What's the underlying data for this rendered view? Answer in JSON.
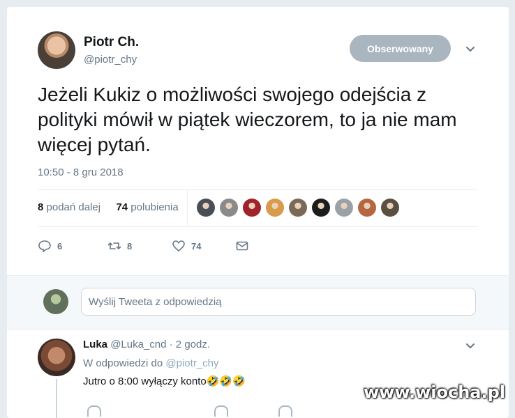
{
  "tweet": {
    "author_name": "Piotr Ch.",
    "author_handle": "@piotr_chy",
    "follow_label": "Obserwowany",
    "text": "Jeżeli Kukiz o możliwości swojego odejścia z polityki mówił w piątek wieczorem, to ja nie mam więcej pytań.",
    "timestamp": "10:50 - 8 gru 2018",
    "retweets_count": "8",
    "retweets_label": "podań dalej",
    "likes_count": "74",
    "likes_label": "polubienia",
    "liker_colors": [
      "#4a4f57",
      "#8a8a8a",
      "#a0232b",
      "#d99a4a",
      "#7a6a55",
      "#1d1d1d",
      "#9aa2a8",
      "#b5673f",
      "#5b5040"
    ],
    "actions": {
      "reply_count": "6",
      "retweet_count": "8",
      "like_count": "74"
    }
  },
  "reply_box": {
    "placeholder": "Wyślij Tweeta z odpowiedzią"
  },
  "reply": {
    "name": "Luka",
    "handle": "@Luka_cnd",
    "time": "· 2 godz.",
    "replying_prefix": "W odpowiedzi do",
    "replying_handle": "@piotr_chy",
    "text": "Jutro o 8:00 wyłączy konto🤣🤣🤣"
  },
  "watermark": "www.wiocha.pl",
  "colors": {
    "background": "#e6ecf0",
    "muted": "#657786",
    "follow_button": "#a9b6c0",
    "link": "#8fa9be"
  }
}
